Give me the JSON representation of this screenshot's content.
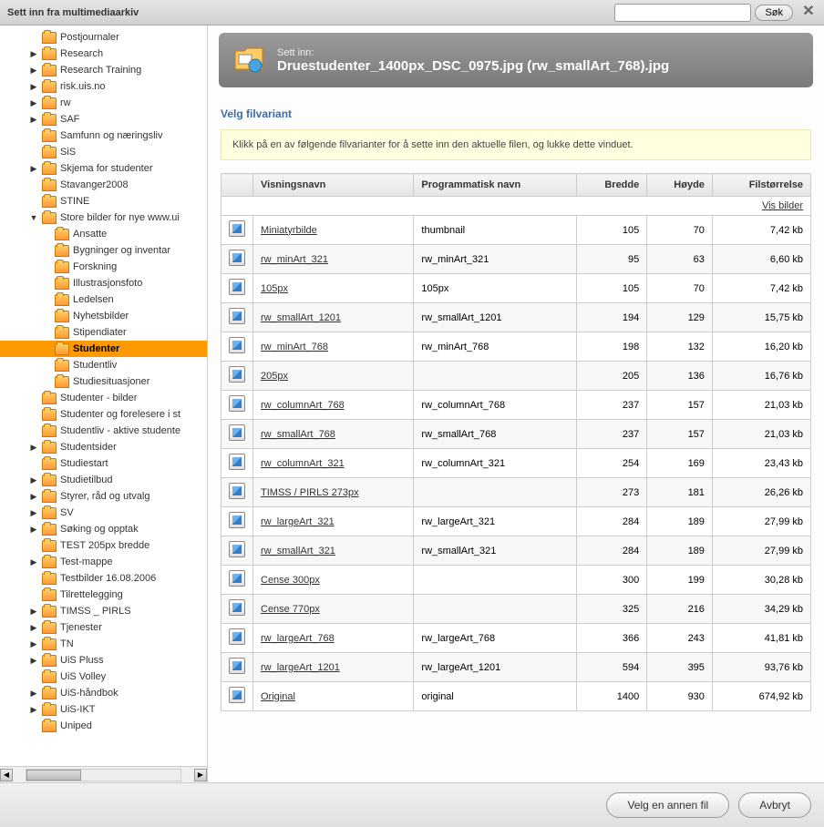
{
  "titlebar": {
    "title": "Sett inn fra multimediaarkiv",
    "search_placeholder": "",
    "search_btn": "Søk"
  },
  "banner": {
    "label": "Sett inn:",
    "filename": "Druestudenter_1400px_DSC_0975.jpg (rw_smallArt_768).jpg"
  },
  "section_title": "Velg filvariant",
  "info_text": "Klikk på en av følgende filvarianter for å sette inn den aktuelle filen, og lukke dette vinduet.",
  "table": {
    "headers": {
      "name": "Visningsnavn",
      "prog": "Programmatisk navn",
      "width": "Bredde",
      "height": "Høyde",
      "size": "Filstørrelse"
    },
    "show_images": "Vis bilder",
    "rows": [
      {
        "name": "Miniatyrbilde",
        "prog": "thumbnail",
        "w": "105",
        "h": "70",
        "size": "7,42 kb"
      },
      {
        "name": "rw_minArt_321",
        "prog": "rw_minArt_321",
        "w": "95",
        "h": "63",
        "size": "6,60 kb"
      },
      {
        "name": "105px",
        "prog": "105px",
        "w": "105",
        "h": "70",
        "size": "7,42 kb"
      },
      {
        "name": "rw_smallArt_1201",
        "prog": "rw_smallArt_1201",
        "w": "194",
        "h": "129",
        "size": "15,75 kb"
      },
      {
        "name": "rw_minArt_768",
        "prog": "rw_minArt_768",
        "w": "198",
        "h": "132",
        "size": "16,20 kb"
      },
      {
        "name": "205px",
        "prog": "",
        "w": "205",
        "h": "136",
        "size": "16,76 kb"
      },
      {
        "name": "rw_columnArt_768",
        "prog": "rw_columnArt_768",
        "w": "237",
        "h": "157",
        "size": "21,03 kb"
      },
      {
        "name": "rw_smallArt_768",
        "prog": "rw_smallArt_768",
        "w": "237",
        "h": "157",
        "size": "21,03 kb"
      },
      {
        "name": "rw_columnArt_321",
        "prog": "rw_columnArt_321",
        "w": "254",
        "h": "169",
        "size": "23,43 kb"
      },
      {
        "name": "TIMSS / PIRLS 273px",
        "prog": "",
        "w": "273",
        "h": "181",
        "size": "26,26 kb"
      },
      {
        "name": "rw_largeArt_321",
        "prog": "rw_largeArt_321",
        "w": "284",
        "h": "189",
        "size": "27,99 kb"
      },
      {
        "name": "rw_smallArt_321",
        "prog": "rw_smallArt_321",
        "w": "284",
        "h": "189",
        "size": "27,99 kb"
      },
      {
        "name": "Cense 300px",
        "prog": "",
        "w": "300",
        "h": "199",
        "size": "30,28 kb"
      },
      {
        "name": "Cense 770px",
        "prog": "",
        "w": "325",
        "h": "216",
        "size": "34,29 kb"
      },
      {
        "name": "rw_largeArt_768",
        "prog": "rw_largeArt_768",
        "w": "366",
        "h": "243",
        "size": "41,81 kb"
      },
      {
        "name": "rw_largeArt_1201",
        "prog": "rw_largeArt_1201",
        "w": "594",
        "h": "395",
        "size": "93,76 kb"
      },
      {
        "name": "Original",
        "prog": "original",
        "w": "1400",
        "h": "930",
        "size": "674,92 kb"
      }
    ]
  },
  "tree": [
    {
      "indent": 2,
      "arrow": "",
      "label": "Postjournaler"
    },
    {
      "indent": 2,
      "arrow": "▶",
      "label": "Research"
    },
    {
      "indent": 2,
      "arrow": "▶",
      "label": "Research Training"
    },
    {
      "indent": 2,
      "arrow": "▶",
      "label": "risk.uis.no"
    },
    {
      "indent": 2,
      "arrow": "▶",
      "label": "rw"
    },
    {
      "indent": 2,
      "arrow": "▶",
      "label": "SAF"
    },
    {
      "indent": 2,
      "arrow": "",
      "label": "Samfunn og næringsliv"
    },
    {
      "indent": 2,
      "arrow": "",
      "label": "SiS"
    },
    {
      "indent": 2,
      "arrow": "▶",
      "label": "Skjema for studenter"
    },
    {
      "indent": 2,
      "arrow": "",
      "label": "Stavanger2008"
    },
    {
      "indent": 2,
      "arrow": "",
      "label": "STINE"
    },
    {
      "indent": 2,
      "arrow": "▼",
      "label": "Store bilder for nye www.ui"
    },
    {
      "indent": 3,
      "arrow": "",
      "label": "Ansatte"
    },
    {
      "indent": 3,
      "arrow": "",
      "label": "Bygninger og inventar"
    },
    {
      "indent": 3,
      "arrow": "",
      "label": "Forskning"
    },
    {
      "indent": 3,
      "arrow": "",
      "label": "Illustrasjonsfoto"
    },
    {
      "indent": 3,
      "arrow": "",
      "label": "Ledelsen"
    },
    {
      "indent": 3,
      "arrow": "",
      "label": "Nyhetsbilder"
    },
    {
      "indent": 3,
      "arrow": "",
      "label": "Stipendiater"
    },
    {
      "indent": 3,
      "arrow": "",
      "label": "Studenter",
      "selected": true
    },
    {
      "indent": 3,
      "arrow": "",
      "label": "Studentliv"
    },
    {
      "indent": 3,
      "arrow": "",
      "label": "Studiesituasjoner"
    },
    {
      "indent": 2,
      "arrow": "",
      "label": "Studenter - bilder"
    },
    {
      "indent": 2,
      "arrow": "",
      "label": "Studenter og forelesere i st"
    },
    {
      "indent": 2,
      "arrow": "",
      "label": "Studentliv - aktive studente"
    },
    {
      "indent": 2,
      "arrow": "▶",
      "label": "Studentsider"
    },
    {
      "indent": 2,
      "arrow": "",
      "label": "Studiestart"
    },
    {
      "indent": 2,
      "arrow": "▶",
      "label": "Studietilbud"
    },
    {
      "indent": 2,
      "arrow": "▶",
      "label": "Styrer, råd og utvalg"
    },
    {
      "indent": 2,
      "arrow": "▶",
      "label": "SV"
    },
    {
      "indent": 2,
      "arrow": "▶",
      "label": "Søking og opptak"
    },
    {
      "indent": 2,
      "arrow": "",
      "label": "TEST 205px bredde"
    },
    {
      "indent": 2,
      "arrow": "▶",
      "label": "Test-mappe"
    },
    {
      "indent": 2,
      "arrow": "",
      "label": "Testbilder 16.08.2006"
    },
    {
      "indent": 2,
      "arrow": "",
      "label": "Tilrettelegging"
    },
    {
      "indent": 2,
      "arrow": "▶",
      "label": "TIMSS _ PIRLS"
    },
    {
      "indent": 2,
      "arrow": "▶",
      "label": "Tjenester"
    },
    {
      "indent": 2,
      "arrow": "▶",
      "label": "TN"
    },
    {
      "indent": 2,
      "arrow": "▶",
      "label": "UiS Pluss"
    },
    {
      "indent": 2,
      "arrow": "",
      "label": "UiS Volley"
    },
    {
      "indent": 2,
      "arrow": "▶",
      "label": "UiS-håndbok"
    },
    {
      "indent": 2,
      "arrow": "▶",
      "label": "UiS-IKT"
    },
    {
      "indent": 2,
      "arrow": "",
      "label": "Uniped"
    }
  ],
  "footer": {
    "choose_other": "Velg en annen fil",
    "cancel": "Avbryt"
  }
}
